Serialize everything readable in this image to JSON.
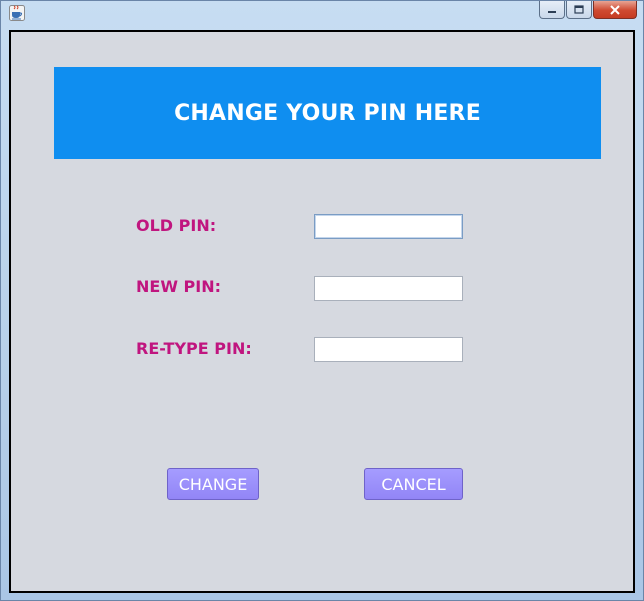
{
  "window": {
    "icon": "java-cup-icon",
    "controls": [
      "minimize-icon",
      "maximize-icon",
      "close-icon"
    ]
  },
  "banner": {
    "title": "CHANGE YOUR PIN HERE"
  },
  "form": {
    "old_pin_label": "OLD PIN:",
    "old_pin_value": "",
    "new_pin_label": "NEW PIN:",
    "new_pin_value": "",
    "retype_pin_label": "RE-TYPE PIN:",
    "retype_pin_value": ""
  },
  "buttons": {
    "change_label": "CHANGE",
    "cancel_label": "CANCEL"
  },
  "colors": {
    "banner": "#0f8ef0",
    "label": "#c0157f",
    "button": "#9285f6",
    "background": "#d6d9e0"
  }
}
